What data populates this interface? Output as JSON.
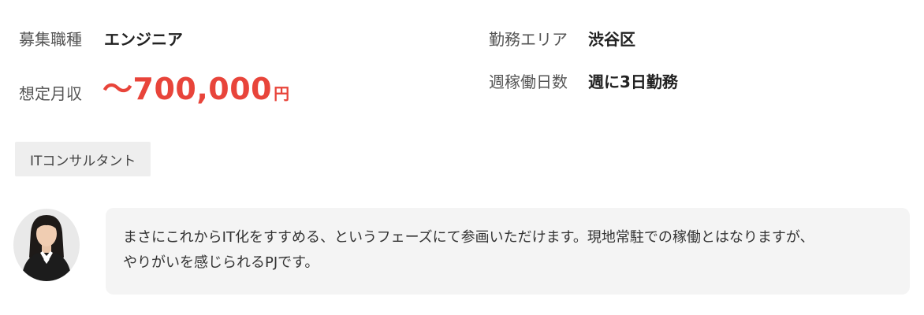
{
  "job": {
    "label": "募集職種",
    "value": "エンジニア"
  },
  "area": {
    "label": "勤務エリア",
    "value": "渋谷区"
  },
  "salary": {
    "label": "想定月収",
    "value": "～700,000",
    "unit": "円"
  },
  "days": {
    "label": "週稼働日数",
    "value": "週に3日勤務"
  },
  "tag": "ITコンサルタント",
  "comment": {
    "line1": "まさにこれからIT化をすすめる、というフェーズにて参画いただけます。現地常駐での稼働とはなりますが、",
    "line2": "やりがいを感じられるPJです。"
  },
  "colors": {
    "accent": "#e8443a",
    "tag_bg": "#eeeeee",
    "bubble_bg": "#f4f4f4"
  },
  "icons": {
    "avatar": "person-photo"
  }
}
